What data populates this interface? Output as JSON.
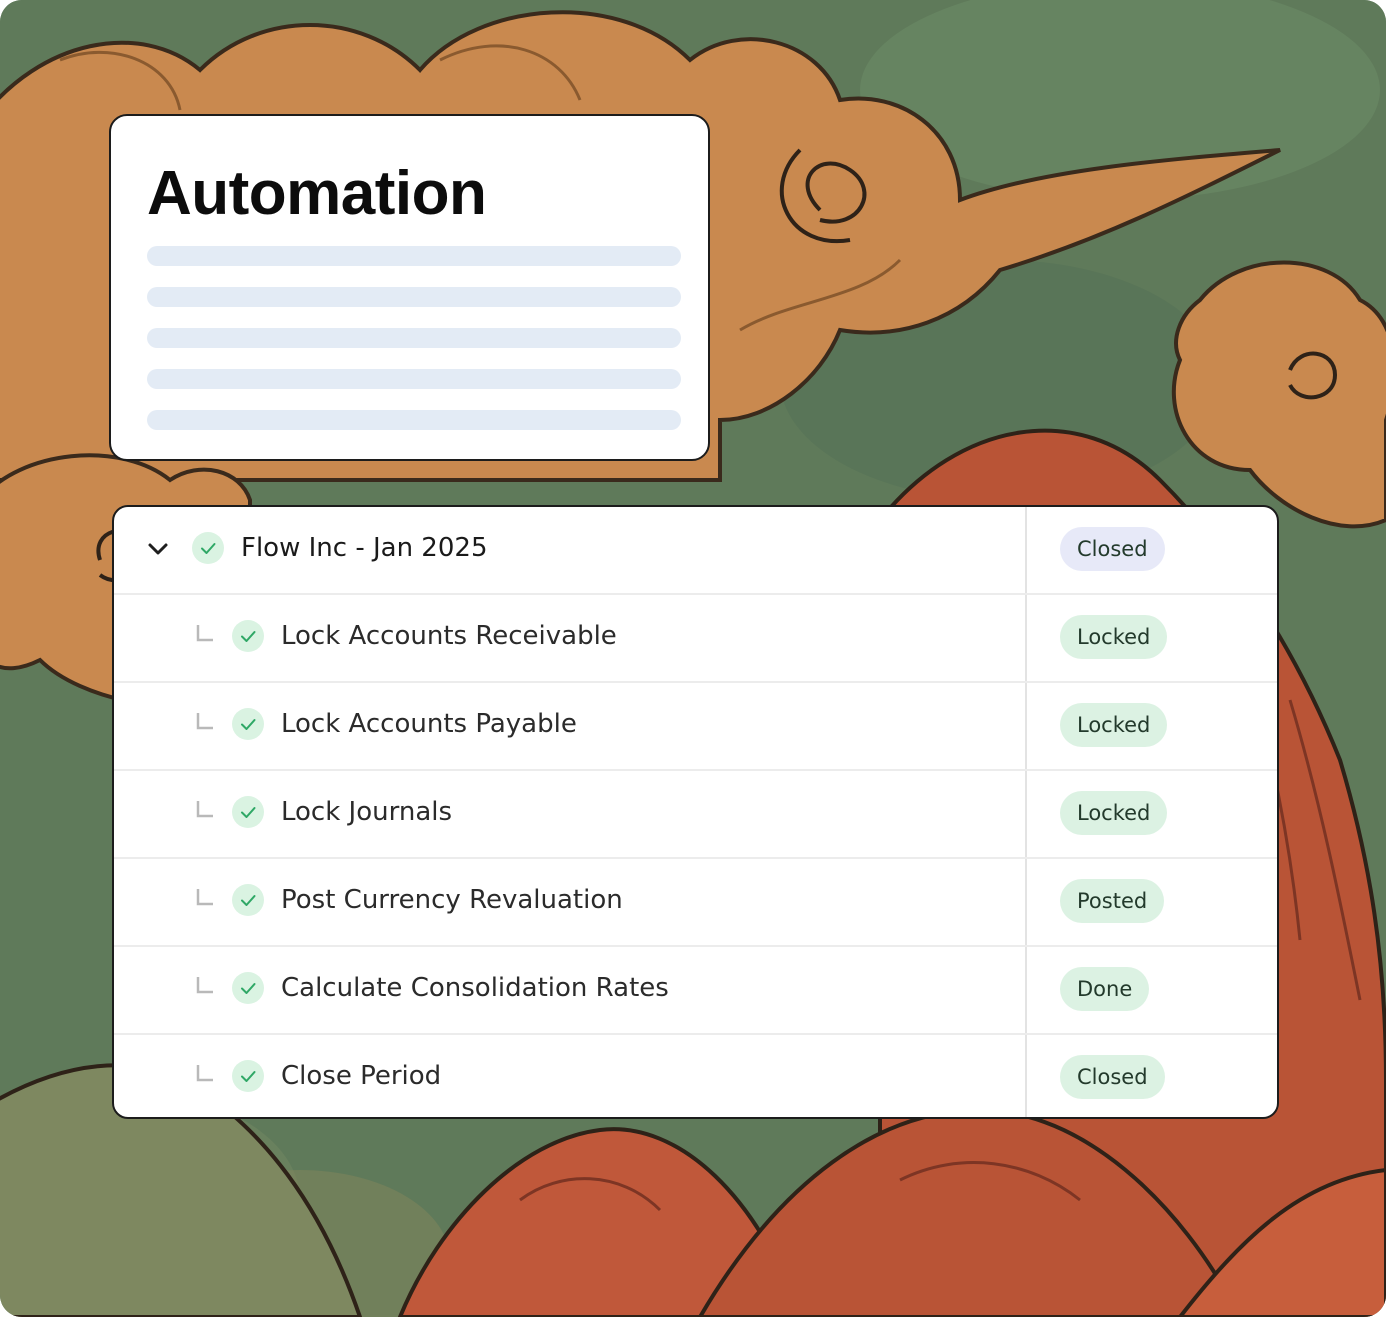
{
  "automation_card": {
    "title": "Automation",
    "placeholder_line_count": 5
  },
  "task_table": {
    "header": {
      "label": "Flow Inc - Jan 2025",
      "status": "Closed",
      "status_color": "#e7e9f8",
      "expanded": true,
      "icon": "chevron-down-icon"
    },
    "rows": [
      {
        "label": "Lock Accounts Receivable",
        "status": "Locked",
        "status_color": "#dcf2e3"
      },
      {
        "label": "Lock Accounts Payable",
        "status": "Locked",
        "status_color": "#dcf2e3"
      },
      {
        "label": "Lock Journals",
        "status": "Locked",
        "status_color": "#dcf2e3"
      },
      {
        "label": "Post Currency Revaluation",
        "status": "Posted",
        "status_color": "#dcf2e3"
      },
      {
        "label": "Calculate Consolidation Rates",
        "status": "Done",
        "status_color": "#dcf2e3"
      },
      {
        "label": "Close Period",
        "status": "Closed",
        "status_color": "#dcf2e3"
      }
    ],
    "complete_icon": "check-circle-icon",
    "complete_icon_color": "#2fa866",
    "child_icon": "tree-elbow-icon"
  },
  "colors": {
    "background_green": "#5f7a5a",
    "cloud_ochre": "#c9894f",
    "mountain_red": "#b95436",
    "placeholder_line": "#e3ebf5"
  }
}
